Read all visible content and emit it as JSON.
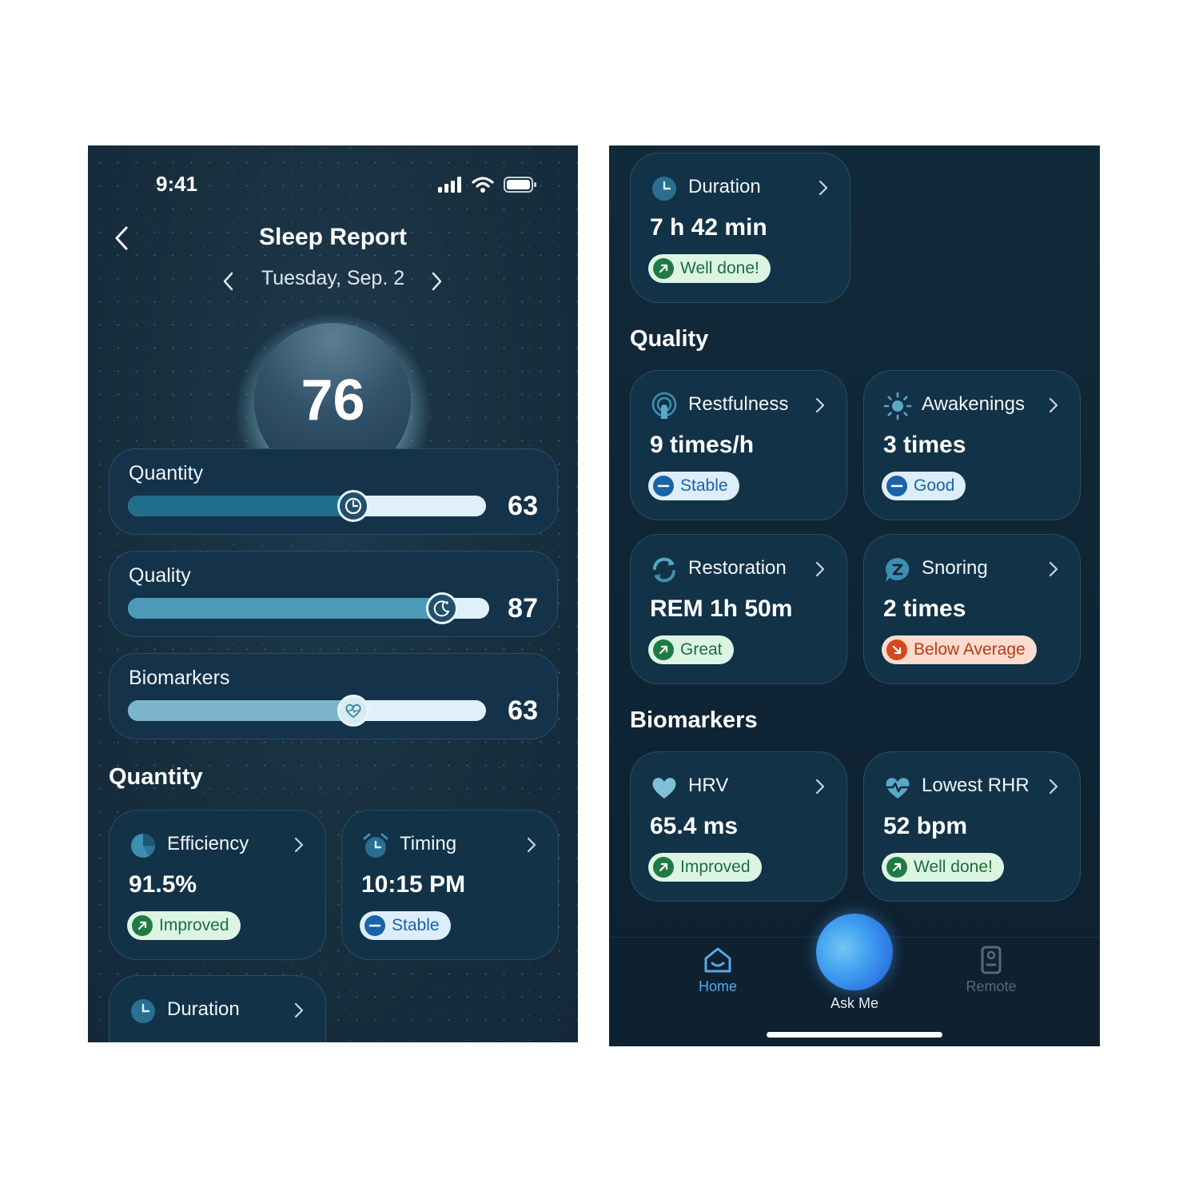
{
  "left_screen": {
    "status": {
      "time": "9:41"
    },
    "header": {
      "title": "Sleep Report",
      "date": "Tuesday, Sep. 2"
    },
    "score": "76",
    "metrics": [
      {
        "label": "Quantity",
        "value": "63",
        "fill_percent": 63,
        "icon": "clock-icon",
        "color": "#1f6f8d"
      },
      {
        "label": "Quality",
        "value": "87",
        "fill_percent": 87,
        "icon": "moon-icon",
        "color": "#4a9ab8"
      },
      {
        "label": "Biomarkers",
        "value": "63",
        "fill_percent": 63,
        "icon": "heart-pulse-icon",
        "color": "#7db6cc"
      }
    ],
    "section_quantity": "Quantity",
    "tiles": [
      {
        "title": "Efficiency",
        "value": "91.5%",
        "badge": "Improved",
        "badge_type": "green",
        "icon": "pie-chart-icon"
      },
      {
        "title": "Timing",
        "value": "10:15 PM",
        "badge": "Stable",
        "badge_type": "blue",
        "icon": "alarm-clock-icon"
      },
      {
        "title": "Duration",
        "icon": "clock-icon"
      }
    ]
  },
  "right_screen": {
    "duration_tile": {
      "title": "Duration",
      "value": "7 h 42 min",
      "badge": "Well done!",
      "badge_type": "green",
      "icon": "clock-icon"
    },
    "section_quality": "Quality",
    "quality_tiles": [
      {
        "title": "Restfulness",
        "value": "9 times/h",
        "badge": "Stable",
        "badge_type": "blue",
        "icon": "signal-head-icon"
      },
      {
        "title": "Awakenings",
        "value": "3 times",
        "badge": "Good",
        "badge_type": "blue",
        "icon": "sun-icon"
      },
      {
        "title": "Restoration",
        "value": "REM 1h 50m",
        "badge": "Great",
        "badge_type": "green",
        "icon": "refresh-icon"
      },
      {
        "title": "Snoring",
        "value": "2 times",
        "badge": "Below Average",
        "badge_type": "red",
        "icon": "snore-bubble-icon"
      }
    ],
    "section_biomarkers": "Biomarkers",
    "biomarker_tiles": [
      {
        "title": "HRV",
        "value": "65.4 ms",
        "badge": "Improved",
        "badge_type": "green",
        "icon": "heart-icon"
      },
      {
        "title": "Lowest RHR",
        "value": "52 bpm",
        "badge": "Well done!",
        "badge_type": "green",
        "icon": "heart-pulse-icon"
      }
    ],
    "tabbar": {
      "home": "Home",
      "ask": "Ask Me",
      "remote": "Remote"
    }
  },
  "colors": {
    "accent": "#58a9e6",
    "good": "#1f7a43",
    "stable": "#1a63a9",
    "warning": "#d24a1f"
  }
}
